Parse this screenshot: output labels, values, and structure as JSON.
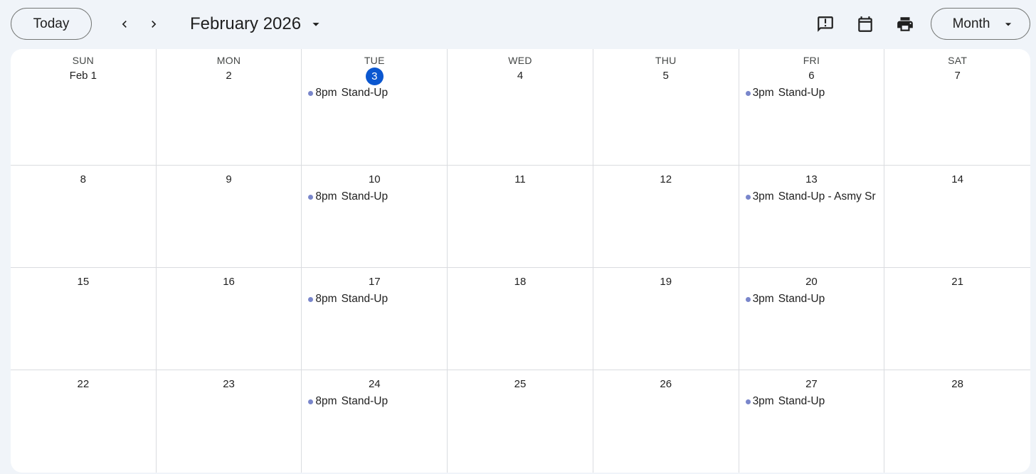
{
  "toolbar": {
    "today_label": "Today",
    "prev_icon": "chevron-left-icon",
    "next_icon": "chevron-right-icon",
    "month_title": "February 2026",
    "month_dropdown_icon": "arrow-drop-down-icon",
    "feedback_icon": "feedback-icon",
    "calendar_icon": "calendar-icon",
    "print_icon": "print-icon",
    "view_label": "Month",
    "view_dropdown_icon": "arrow-drop-down-icon"
  },
  "colors": {
    "today_highlight": "#0b57d0",
    "event_dot": "#7986cb",
    "background": "#f0f4f9"
  },
  "weekdays": [
    "SUN",
    "MON",
    "TUE",
    "WED",
    "THU",
    "FRI",
    "SAT"
  ],
  "weeks": [
    [
      {
        "day": "Feb 1",
        "events": []
      },
      {
        "day": "2",
        "events": []
      },
      {
        "day": "3",
        "today": true,
        "events": [
          {
            "time": "8pm",
            "title": "Stand-Up"
          }
        ]
      },
      {
        "day": "4",
        "events": []
      },
      {
        "day": "5",
        "events": []
      },
      {
        "day": "6",
        "events": [
          {
            "time": "3pm",
            "title": "Stand-Up"
          }
        ]
      },
      {
        "day": "7",
        "events": []
      }
    ],
    [
      {
        "day": "8",
        "events": []
      },
      {
        "day": "9",
        "events": []
      },
      {
        "day": "10",
        "events": [
          {
            "time": "8pm",
            "title": "Stand-Up"
          }
        ]
      },
      {
        "day": "11",
        "events": []
      },
      {
        "day": "12",
        "events": []
      },
      {
        "day": "13",
        "events": [
          {
            "time": "3pm",
            "title": "Stand-Up - Asmy Sr"
          }
        ]
      },
      {
        "day": "14",
        "events": []
      }
    ],
    [
      {
        "day": "15",
        "events": []
      },
      {
        "day": "16",
        "events": []
      },
      {
        "day": "17",
        "events": [
          {
            "time": "8pm",
            "title": "Stand-Up"
          }
        ]
      },
      {
        "day": "18",
        "events": []
      },
      {
        "day": "19",
        "events": []
      },
      {
        "day": "20",
        "events": [
          {
            "time": "3pm",
            "title": "Stand-Up"
          }
        ]
      },
      {
        "day": "21",
        "events": []
      }
    ],
    [
      {
        "day": "22",
        "events": []
      },
      {
        "day": "23",
        "events": []
      },
      {
        "day": "24",
        "events": [
          {
            "time": "8pm",
            "title": "Stand-Up"
          }
        ]
      },
      {
        "day": "25",
        "events": []
      },
      {
        "day": "26",
        "events": []
      },
      {
        "day": "27",
        "events": [
          {
            "time": "3pm",
            "title": "Stand-Up"
          }
        ]
      },
      {
        "day": "28",
        "events": []
      }
    ]
  ]
}
